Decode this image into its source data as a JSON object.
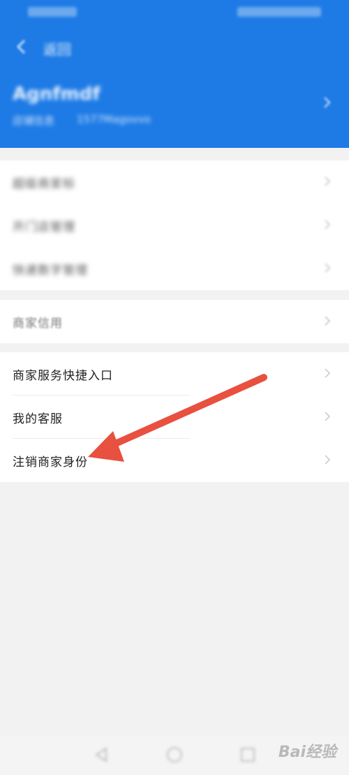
{
  "header": {
    "title": "返回",
    "shop_name": "Agnfmdf",
    "meta_left": "店铺信息",
    "meta_right": "1577Magovvo"
  },
  "menu_group_1": [
    {
      "label": "超级商家标"
    },
    {
      "label": "开门店管理"
    },
    {
      "label": "快递数字管理"
    }
  ],
  "menu_group_2": [
    {
      "label": "商家信用"
    }
  ],
  "menu_group_3": [
    {
      "label": "商家服务快捷入口"
    },
    {
      "label": "我的客服"
    },
    {
      "label": "注销商家身份"
    }
  ],
  "watermark": "Bai经验",
  "icons": {
    "back": "chevron-left-icon",
    "row": "chevron-right-icon",
    "nav": [
      "back-triangle-icon",
      "home-circle-icon",
      "recent-square-icon"
    ]
  },
  "colors": {
    "header_blue": "#1e7be6",
    "arrow_red": "#e8503f"
  }
}
